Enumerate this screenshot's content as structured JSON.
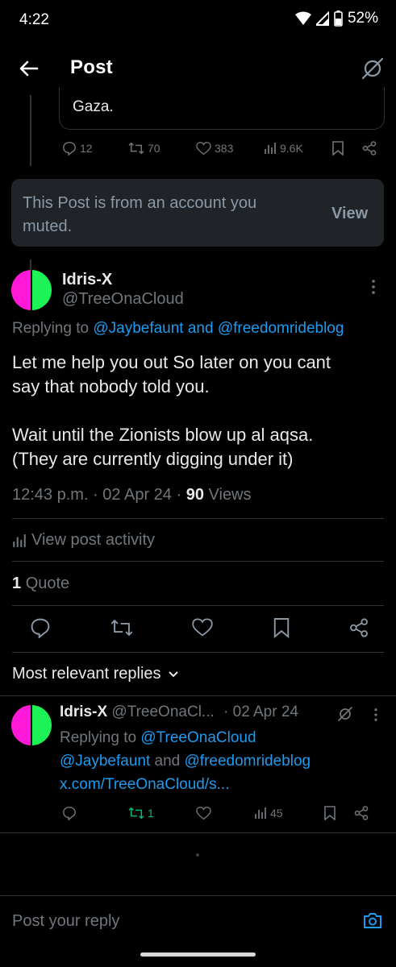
{
  "status_bar": {
    "time": "4:22",
    "battery": "52%"
  },
  "header": {
    "title": "Post"
  },
  "quoted_tail": {
    "text": "Gaza.",
    "replies": "12",
    "reposts": "70",
    "likes": "383",
    "views": "9.6K"
  },
  "muted_notice": {
    "text": "This Post is from an account you muted.",
    "view_label": "View"
  },
  "main_post": {
    "name": "Idris-X",
    "handle": "@TreeOnaCloud",
    "replying_prefix": "Replying to ",
    "replying_users": "@Jaybefaunt and @freedomrideblog",
    "body_line1": "Let me help you out So later on you cant",
    "body_line2": "say that nobody told you.",
    "body_line3": "Wait until the Zionists blow up al aqsa.",
    "body_line4": "(They are currently digging under it)",
    "time": "12:43 p.m.",
    "date": "02 Apr 24",
    "views_count": "90",
    "views_label": "Views",
    "activity_label": "View post activity",
    "quote_count": "1",
    "quote_label": "Quote"
  },
  "replies_section": {
    "label": "Most relevant replies"
  },
  "reply": {
    "name": "Idris-X",
    "handle": "@TreeOnaCl...",
    "date": "· 02 Apr 24",
    "replying_prefix": "Replying to ",
    "replying_user1": "@TreeOnaCloud",
    "replying_user2": "@Jaybefaunt",
    "replying_and": " and ",
    "replying_user3": "@freedomrideblog",
    "link": "x.com/TreeOnaCloud/s...",
    "reposts": "1",
    "views": "45",
    "repost_color": "#00ba7c"
  },
  "composer": {
    "placeholder": "Post your reply"
  },
  "colors": {
    "accent": "#1d9bf0",
    "muted_bg": "#202327",
    "avatar_left": "#ff18d8",
    "avatar_right": "#1df256"
  }
}
